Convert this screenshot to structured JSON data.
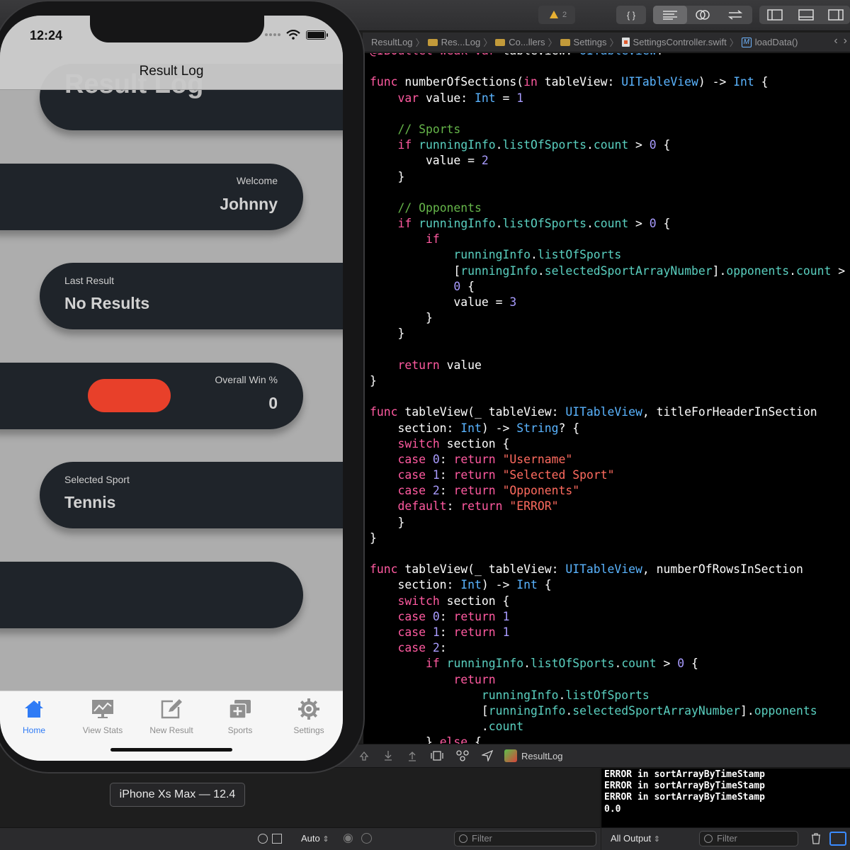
{
  "xcode": {
    "warnings": {
      "count": "2"
    },
    "toolbar_icons": [
      "braces-icon",
      "editor-standard-icon",
      "editor-assistant-icon",
      "editor-version-icon",
      "navigator-toggle-icon",
      "debug-area-toggle-icon",
      "inspector-toggle-icon"
    ],
    "jumpbar": {
      "items": [
        "ResultLog",
        "Res...Log",
        "Co...llers",
        "Settings",
        "SettingsController.swift",
        "loadData()"
      ],
      "method_badge": "M"
    },
    "code_lines": [
      "@IBOutlet weak var tableView: UITableView!",
      "",
      "func numberOfSections(in tableView: UITableView) -> Int {",
      "    var value: Int = 1",
      "",
      "    // Sports",
      "    if runningInfo.listOfSports.count > 0 {",
      "        value = 2",
      "    }",
      "",
      "    // Opponents",
      "    if runningInfo.listOfSports.count > 0 {",
      "        if",
      "            runningInfo.listOfSports",
      "            [runningInfo.selectedSportArrayNumber].opponents.count >",
      "            0 {",
      "            value = 3",
      "        }",
      "    }",
      "",
      "    return value",
      "}",
      "",
      "func tableView(_ tableView: UITableView, titleForHeaderInSection",
      "    section: Int) -> String? {",
      "    switch section {",
      "    case 0: return \"Username\"",
      "    case 1: return \"Selected Sport\"",
      "    case 2: return \"Opponents\"",
      "    default: return \"ERROR\"",
      "    }",
      "}",
      "",
      "func tableView(_ tableView: UITableView, numberOfRowsInSection",
      "    section: Int) -> Int {",
      "    switch section {",
      "    case 0: return 1",
      "    case 1: return 1",
      "    case 2:",
      "        if runningInfo.listOfSports.count > 0 {",
      "            return",
      "                runningInfo.listOfSports",
      "                [runningInfo.selectedSportArrayNumber].opponents",
      "                .count",
      "        } else {"
    ],
    "debug": {
      "target": "ResultLog",
      "variables_scope": "Auto",
      "filter_placeholder": "Filter",
      "output_scope": "All Output",
      "console_lines": [
        "ERROR in sortArrayByTimeStamp",
        "ERROR in sortArrayByTimeStamp",
        "ERROR in sortArrayByTimeStamp",
        "0.0"
      ]
    },
    "colors": {
      "keyword": "#ff5aa0",
      "type": "#5ab4ff",
      "member": "#5ad0c0",
      "number": "#a99cff",
      "string": "#ff6b5f",
      "comment": "#66b64a"
    }
  },
  "simulator": {
    "device_label": "iPhone Xs Max — 12.4",
    "status": {
      "time": "12:24"
    },
    "nav_title": "Result Log",
    "cards": {
      "header_title": "Result Log",
      "welcome_label": "Welcome",
      "welcome_value": "Johnny",
      "last_result_label": "Last Result",
      "last_result_value": "No Results",
      "win_label": "Overall Win %",
      "win_value": "0",
      "sport_label": "Selected Sport",
      "sport_value": "Tennis"
    },
    "tabs": [
      {
        "label": "Home",
        "icon": "house-icon",
        "active": true
      },
      {
        "label": "View Stats",
        "icon": "chart-icon",
        "active": false
      },
      {
        "label": "New Result",
        "icon": "compose-icon",
        "active": false
      },
      {
        "label": "Sports",
        "icon": "add-stack-icon",
        "active": false
      },
      {
        "label": "Settings",
        "icon": "gear-icon",
        "active": false
      }
    ],
    "accent_color": "#e8402a",
    "tab_active_color": "#2f7bf5"
  }
}
